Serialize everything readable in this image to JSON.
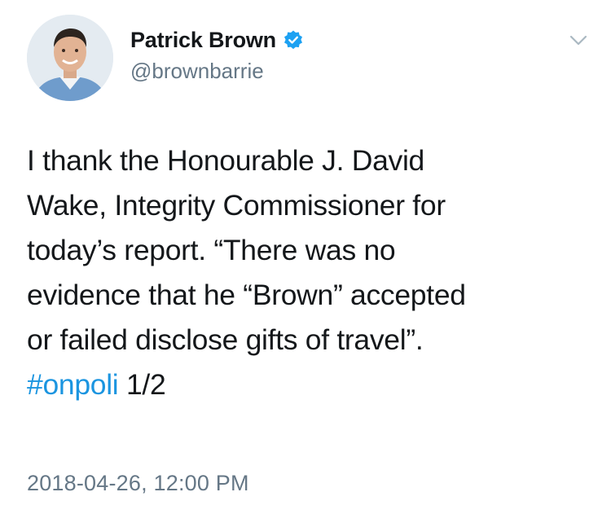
{
  "author": {
    "display_name": "Patrick Brown",
    "handle": "@brownbarrie",
    "verified": true
  },
  "tweet": {
    "lines": [
      "I thank the Honourable J. David",
      "Wake, Integrity Commissioner for",
      "today’s report. “There was no",
      "evidence that he “Brown” accepted",
      "or failed disclose gifts of travel”."
    ],
    "hashtag": "#onpoli",
    "suffix": " 1/2"
  },
  "timestamp": "2018-04-26, 12:00 PM",
  "colors": {
    "link": "#1b95e0",
    "secondary_text": "#657786",
    "verified_badge": "#1da1f2"
  },
  "icons": {
    "verified": "verified-badge-icon",
    "menu": "chevron-down-icon"
  }
}
